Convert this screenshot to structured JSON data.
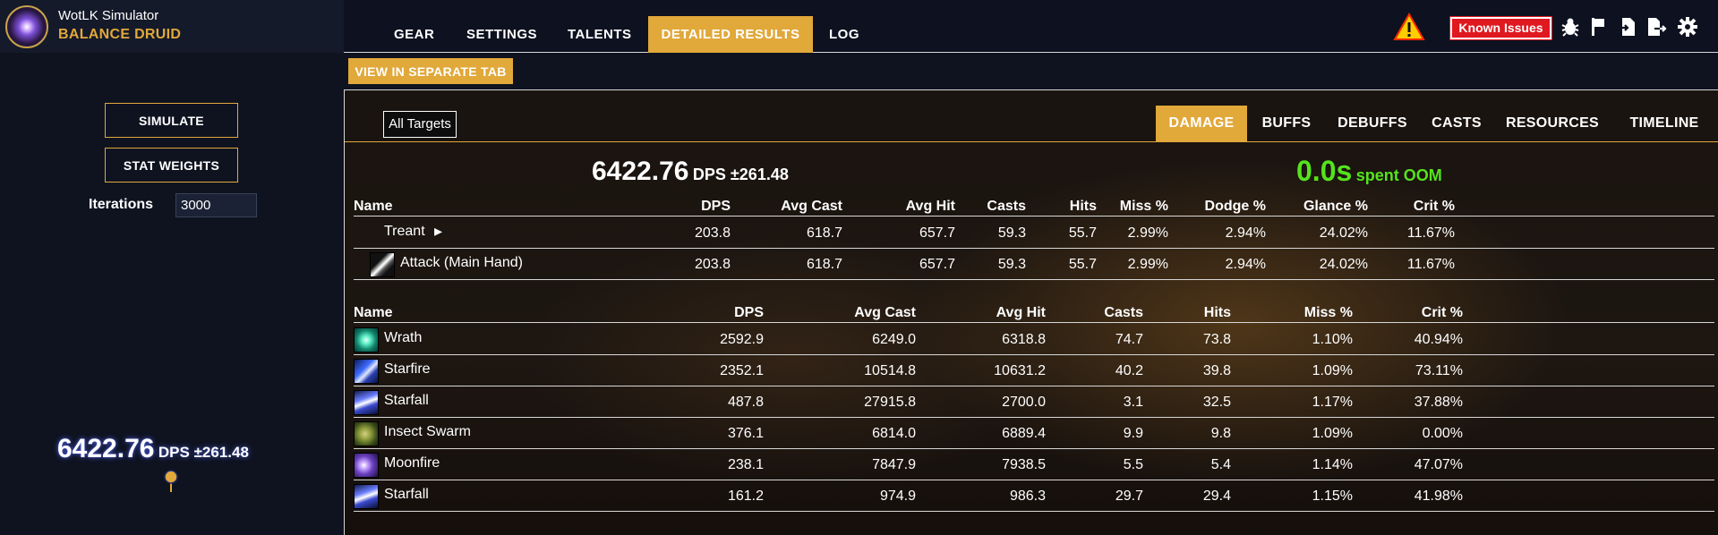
{
  "app": {
    "title": "WotLK Simulator",
    "subtitle": "BALANCE DRUID"
  },
  "nav": {
    "tabs": [
      "GEAR",
      "SETTINGS",
      "TALENTS",
      "DETAILED RESULTS",
      "LOG"
    ],
    "active": "DETAILED RESULTS"
  },
  "toolbar": {
    "known_issues": "Known Issues",
    "icons": [
      "warning-icon",
      "bug-icon",
      "flag-icon",
      "import-icon",
      "export-icon",
      "gear-icon"
    ]
  },
  "sidebar": {
    "simulate": "SIMULATE",
    "stat_weights": "STAT WEIGHTS",
    "iterations_label": "Iterations",
    "iterations_value": "3000",
    "dps_value": "6422.76",
    "dps_suffix": "DPS ±261.48"
  },
  "results": {
    "view_separate": "VIEW IN SEPARATE TAB",
    "target_filter": "All Targets",
    "tabs": [
      "DAMAGE",
      "BUFFS",
      "DEBUFFS",
      "CASTS",
      "RESOURCES",
      "TIMELINE"
    ],
    "active_tab": "DAMAGE",
    "dps_value": "6422.76",
    "dps_suffix": "DPS ±261.48",
    "oom_value": "0.0s",
    "oom_suffix": "spent OOM",
    "colors": {
      "accent": "#e1a83a",
      "oom": "#55e31d",
      "alert": "#e0181f"
    }
  },
  "pet_table": {
    "headers": [
      "Name",
      "DPS",
      "Avg Cast",
      "Avg Hit",
      "Casts",
      "Hits",
      "Miss %",
      "Dodge %",
      "Glance %",
      "Crit %"
    ],
    "rows": [
      {
        "name": "Treant",
        "icon": "",
        "caret": "▸",
        "cells": [
          "203.8",
          "618.7",
          "657.7",
          "59.3",
          "55.7",
          "2.99%",
          "2.94%",
          "24.02%",
          "11.67%"
        ]
      },
      {
        "name": "Attack (Main Hand)",
        "icon": "sword-icon",
        "caret": "",
        "cells": [
          "203.8",
          "618.7",
          "657.7",
          "59.3",
          "55.7",
          "2.99%",
          "2.94%",
          "24.02%",
          "11.67%"
        ]
      }
    ]
  },
  "spell_table": {
    "headers": [
      "Name",
      "DPS",
      "Avg Cast",
      "Avg Hit",
      "Casts",
      "Hits",
      "Miss %",
      "Crit %"
    ],
    "rows": [
      {
        "name": "Wrath",
        "icon": "wrath-icon",
        "cells": [
          "2592.9",
          "6249.0",
          "6318.8",
          "74.7",
          "73.8",
          "1.10%",
          "40.94%"
        ]
      },
      {
        "name": "Starfire",
        "icon": "starfire-icon",
        "cells": [
          "2352.1",
          "10514.8",
          "10631.2",
          "40.2",
          "39.8",
          "1.09%",
          "73.11%"
        ]
      },
      {
        "name": "Starfall",
        "icon": "starfall-icon",
        "cells": [
          "487.8",
          "27915.8",
          "2700.0",
          "3.1",
          "32.5",
          "1.17%",
          "37.88%"
        ]
      },
      {
        "name": "Insect Swarm",
        "icon": "insect-swarm-icon",
        "cells": [
          "376.1",
          "6814.0",
          "6889.4",
          "9.9",
          "9.8",
          "1.09%",
          "0.00%"
        ]
      },
      {
        "name": "Moonfire",
        "icon": "moonfire-icon",
        "cells": [
          "238.1",
          "7847.9",
          "7938.5",
          "5.5",
          "5.4",
          "1.14%",
          "47.07%"
        ]
      },
      {
        "name": "Starfall",
        "icon": "starfall-icon",
        "cells": [
          "161.2",
          "974.9",
          "986.3",
          "29.7",
          "29.4",
          "1.15%",
          "41.98%"
        ]
      }
    ]
  }
}
